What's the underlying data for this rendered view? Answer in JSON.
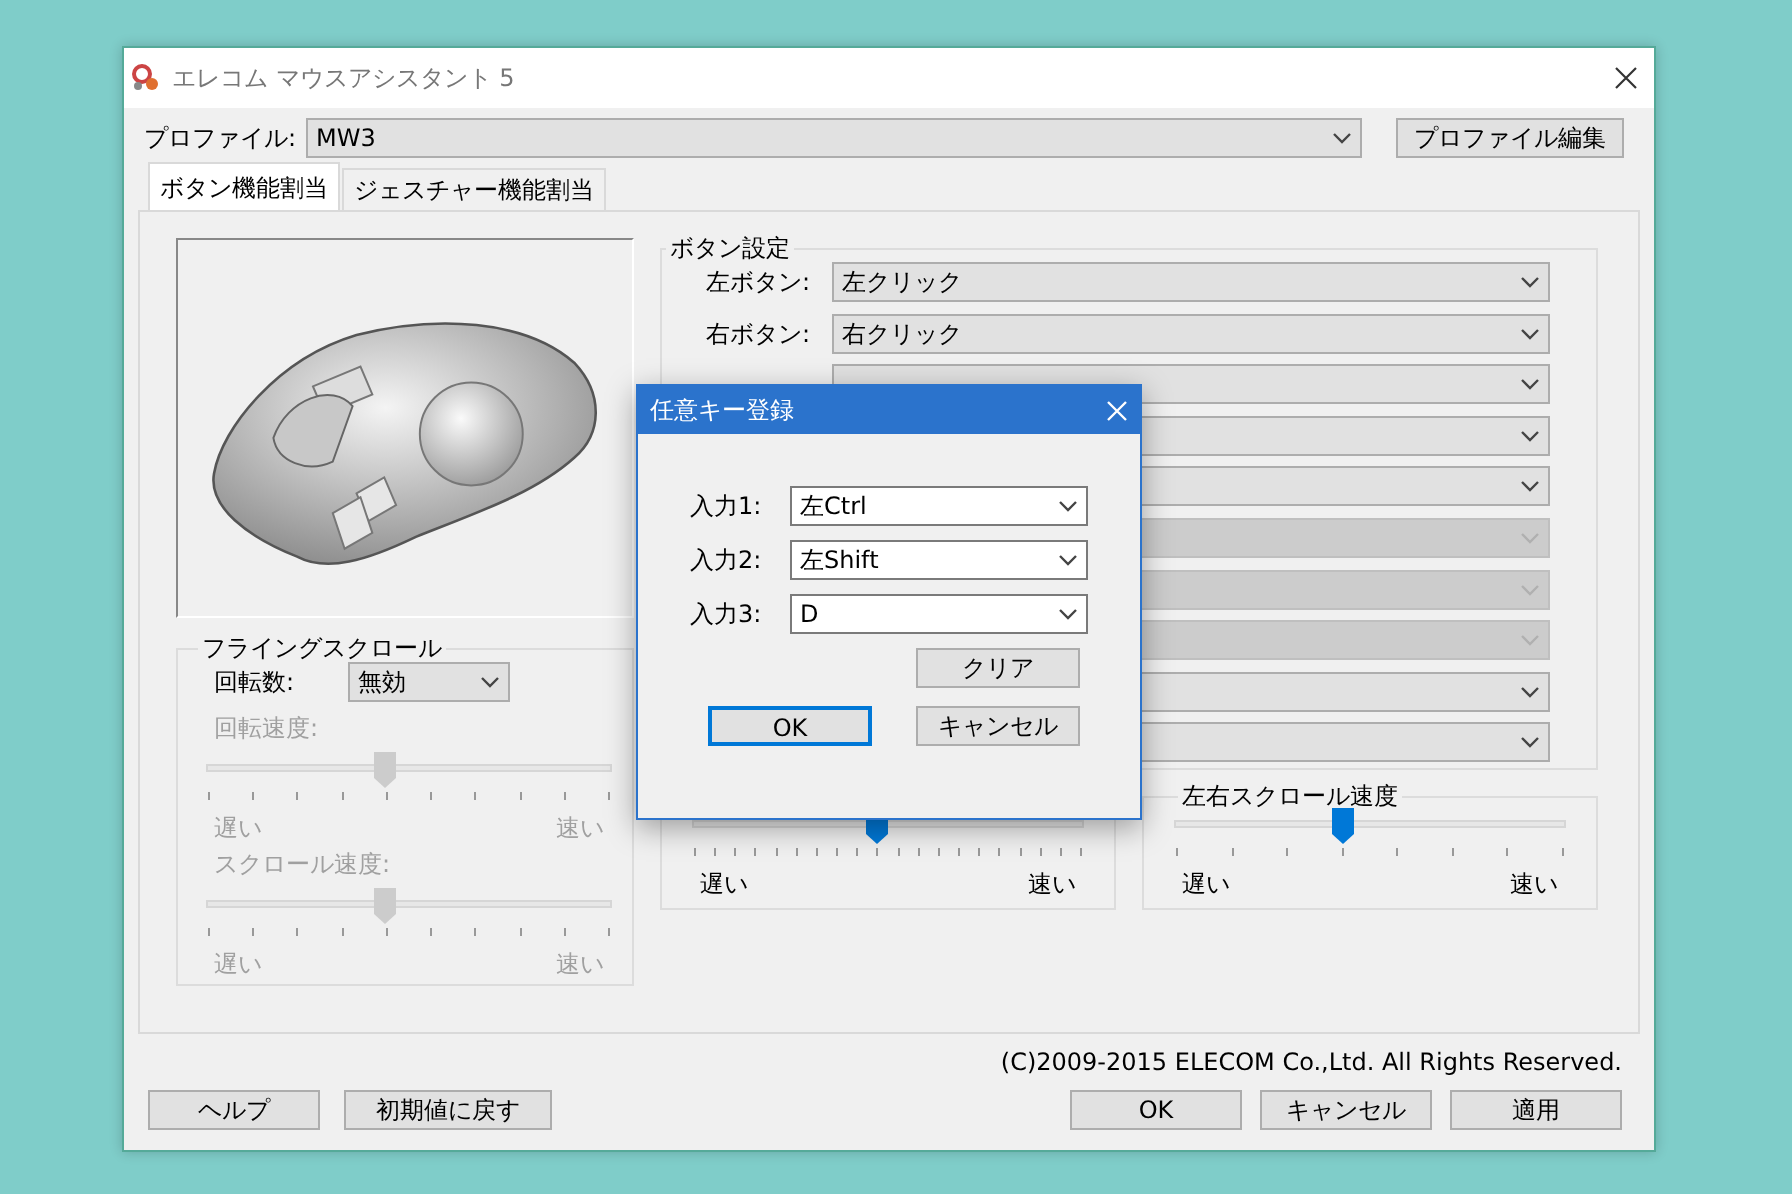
{
  "window": {
    "title": "エレコム マウスアシスタント 5"
  },
  "profile": {
    "label": "プロファイル:",
    "value": "MW3",
    "edit_button": "プロファイル編集"
  },
  "tabs": [
    {
      "label": "ボタン機能割当",
      "selected": true
    },
    {
      "label": "ジェスチャー機能割当",
      "selected": false
    }
  ],
  "flying_scroll": {
    "title": "フライングスクロール",
    "rotation_label": "回転数:",
    "rotation_value": "無効",
    "sliders": [
      {
        "label": "回転速度:",
        "disabled": true,
        "level": 0.44,
        "min_label": "遅い",
        "max_label": "速い"
      },
      {
        "label": "スクロール速度:",
        "disabled": true,
        "level": 0.44,
        "min_label": "遅い",
        "max_label": "速い"
      }
    ]
  },
  "button_settings": {
    "title": "ボタン設定",
    "rows": [
      {
        "label": "左ボタン:",
        "value": "左クリック",
        "disabled": false
      },
      {
        "label": "右ボタン:",
        "value": "右クリック",
        "disabled": false
      },
      {
        "disabled": false
      },
      {
        "disabled": false
      },
      {
        "disabled": false
      },
      {
        "disabled": true
      },
      {
        "disabled": true
      },
      {
        "disabled": true
      },
      {
        "disabled": false
      },
      {
        "disabled": false
      }
    ]
  },
  "speed_groups": [
    {
      "level": 0.47,
      "min_label": "遅い",
      "max_label": "速い"
    },
    {
      "title": "左右スクロール速度",
      "level": 0.43,
      "min_label": "遅い",
      "max_label": "速い"
    }
  ],
  "copyright": "(C)2009-2015 ELECOM Co.,Ltd. All Rights Reserved.",
  "left_buttons": [
    "ヘルプ",
    "初期値に戻す"
  ],
  "right_buttons": [
    "OK",
    "キャンセル",
    "適用"
  ],
  "dialog": {
    "title": "任意キー登録",
    "inputs": [
      {
        "label": "入力1:",
        "value": "左Ctrl"
      },
      {
        "label": "入力2:",
        "value": "左Shift"
      },
      {
        "label": "入力3:",
        "value": "D"
      }
    ],
    "buttons": [
      {
        "label": "クリア",
        "default": false
      },
      {
        "label": "OK",
        "default": true
      },
      {
        "label": "キャンセル",
        "default": false
      }
    ]
  }
}
